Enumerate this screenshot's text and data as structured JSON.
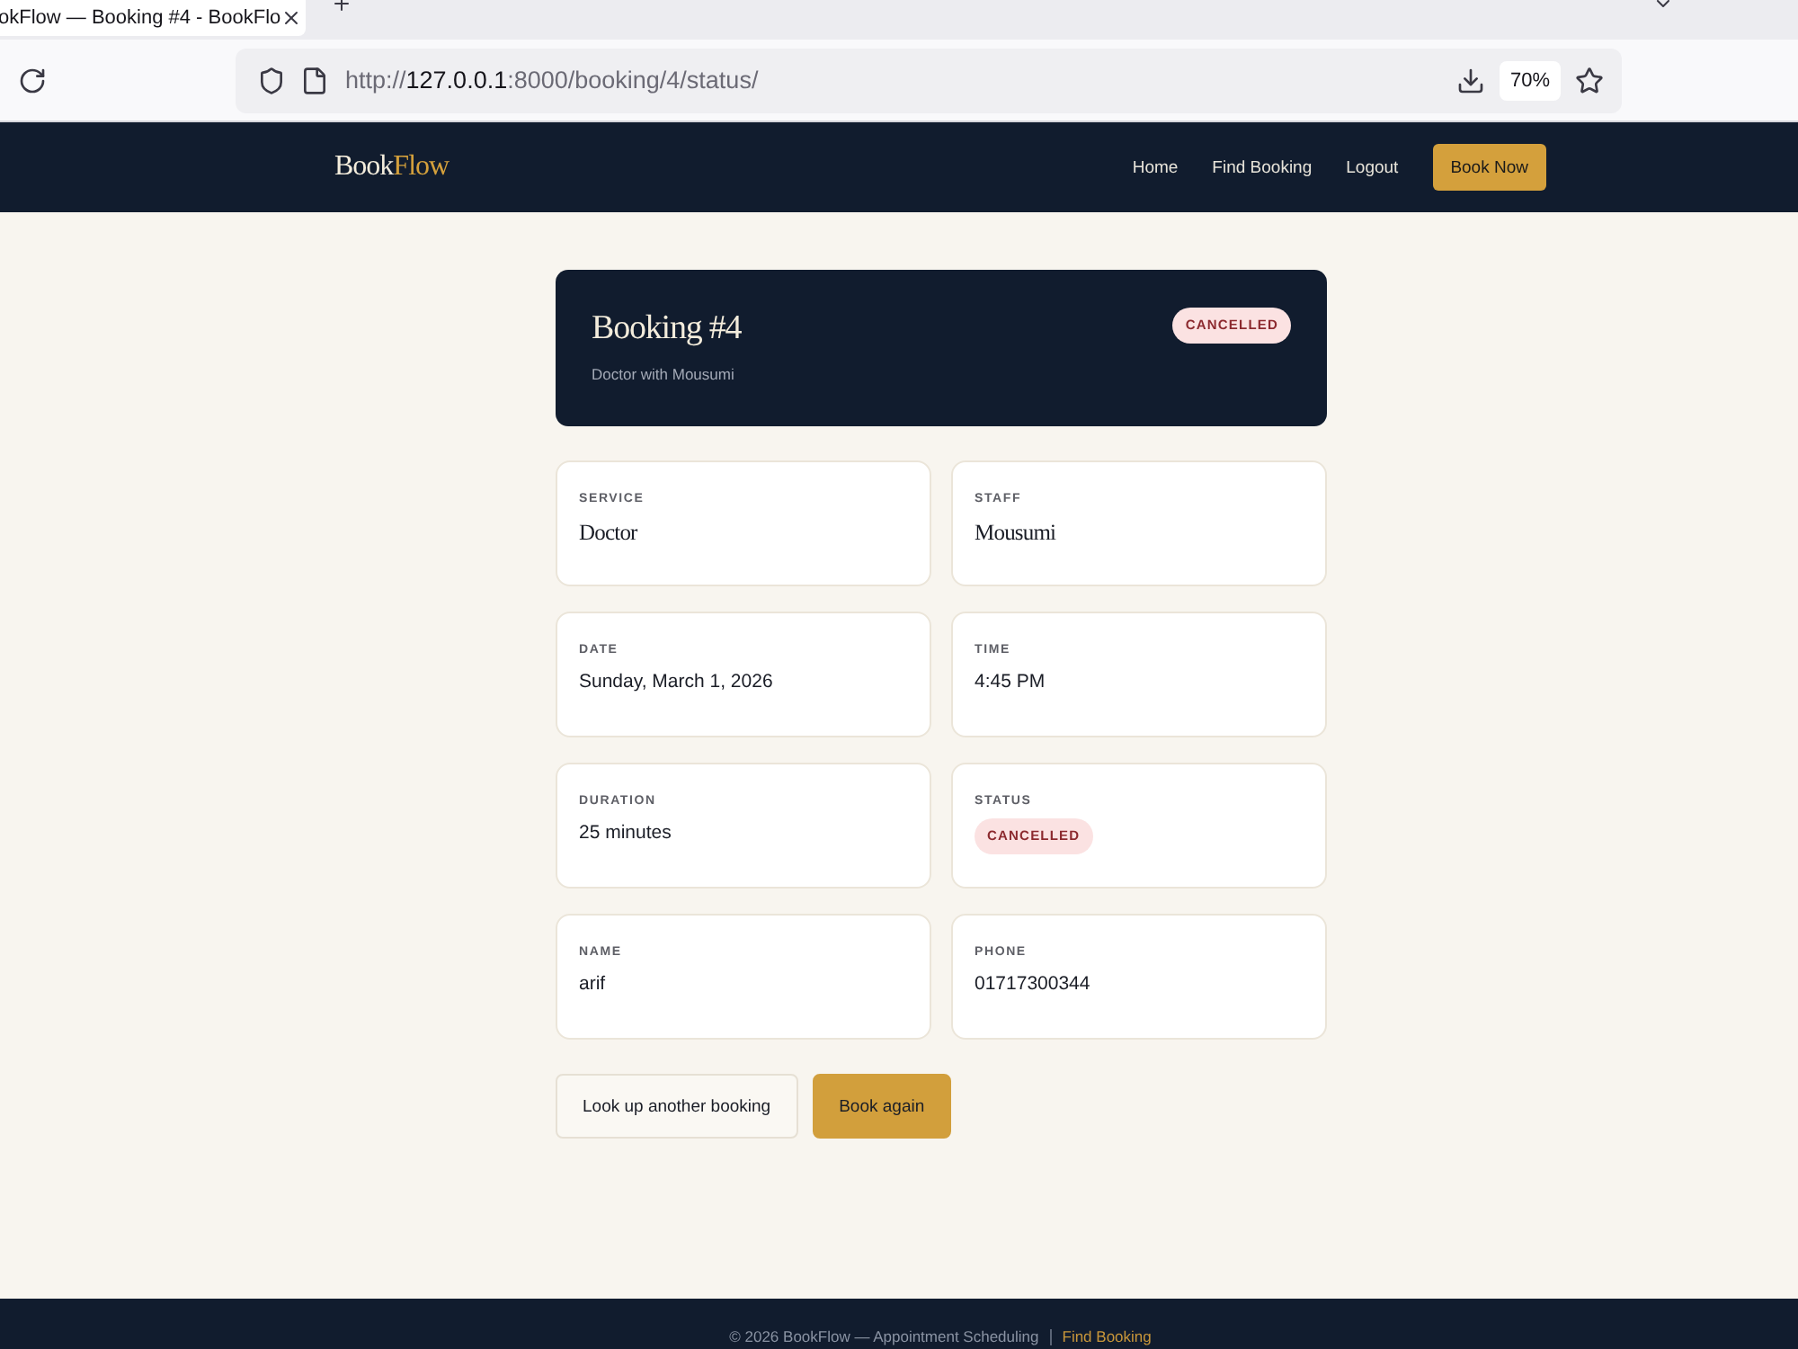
{
  "browser": {
    "tab_title": "okFlow — Booking #4 - BookFlo",
    "url": {
      "scheme": "http://",
      "host": "127.0.0.1",
      "path": ":8000/booking/4/status/"
    },
    "zoom": "70%"
  },
  "navbar": {
    "logo": {
      "part_1": "Book",
      "part_2": "Flow"
    },
    "links": [
      {
        "label": "Home"
      },
      {
        "label": "Find Booking"
      },
      {
        "label": "Logout"
      }
    ],
    "cta": "Book Now"
  },
  "booking": {
    "title": "Booking #4",
    "subtitle": "Doctor with Mousumi",
    "status_badge": "CANCELLED"
  },
  "details": [
    {
      "label": "SERVICE",
      "value": "Doctor",
      "kind": "serif"
    },
    {
      "label": "STAFF",
      "value": "Mousumi",
      "kind": "serif"
    },
    {
      "label": "DATE",
      "value": "Sunday, March 1, 2026",
      "kind": "text"
    },
    {
      "label": "TIME",
      "value": "4:45 PM",
      "kind": "text"
    },
    {
      "label": "DURATION",
      "value": "25 minutes",
      "kind": "text"
    },
    {
      "label": "STATUS",
      "value": "CANCELLED",
      "kind": "status"
    },
    {
      "label": "NAME",
      "value": "arif",
      "kind": "text"
    },
    {
      "label": "PHONE",
      "value": "01717300344",
      "kind": "text"
    }
  ],
  "actions": [
    {
      "label": "Look up another booking",
      "kind": "secondary"
    },
    {
      "label": "Book again",
      "kind": "primary"
    }
  ],
  "footer": {
    "text": "© 2026 BookFlow — Appointment Scheduling",
    "link": "Find Booking"
  }
}
